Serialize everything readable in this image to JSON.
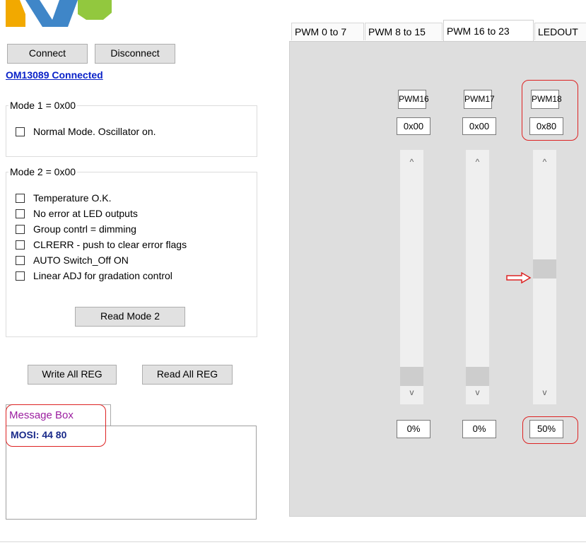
{
  "logo": {
    "colors": [
      "#f2a900",
      "#3f86c8",
      "#92c83e"
    ]
  },
  "toolbar": {
    "connect_label": "Connect",
    "disconnect_label": "Disconnect",
    "status_link": "OM13089 Connected"
  },
  "mode1": {
    "title": "Mode 1 = 0x00",
    "checkboxes": [
      {
        "label": "Normal Mode. Oscillator on.",
        "checked": false
      }
    ]
  },
  "mode2": {
    "title": "Mode 2 = 0x00",
    "checkboxes": [
      {
        "label": "Temperature O.K.",
        "checked": false
      },
      {
        "label": "No error at LED outputs",
        "checked": false
      },
      {
        "label": "Group contrl = dimming",
        "checked": false
      },
      {
        "label": "CLRERR - push to clear error flags",
        "checked": false
      },
      {
        "label": "AUTO Switch_Off ON",
        "checked": false
      },
      {
        "label": "Linear ADJ for gradation control",
        "checked": false
      }
    ],
    "read_button": "Read Mode 2"
  },
  "reg_buttons": {
    "write_all": "Write All REG",
    "read_all": "Read All REG"
  },
  "message_box": {
    "tab_label": "Message Box",
    "content": "MOSI: 44 80"
  },
  "tabs": [
    {
      "label": "PWM 0 to 7",
      "active": false
    },
    {
      "label": "PWM 8 to 15",
      "active": false
    },
    {
      "label": "PWM 16 to 23",
      "active": true
    },
    {
      "label": "LEDOUT",
      "active": false
    }
  ],
  "channels": [
    {
      "name": "PWM16",
      "hex": "0x00",
      "percent": "0%",
      "level": 0.0
    },
    {
      "name": "PWM17",
      "hex": "0x00",
      "percent": "0%",
      "level": 0.0
    },
    {
      "name": "PWM18",
      "hex": "0x80",
      "percent": "50%",
      "level": 0.5
    }
  ],
  "colors": {
    "highlight_ring": "#dd2222",
    "pointer_arrow": "#dd2222"
  }
}
